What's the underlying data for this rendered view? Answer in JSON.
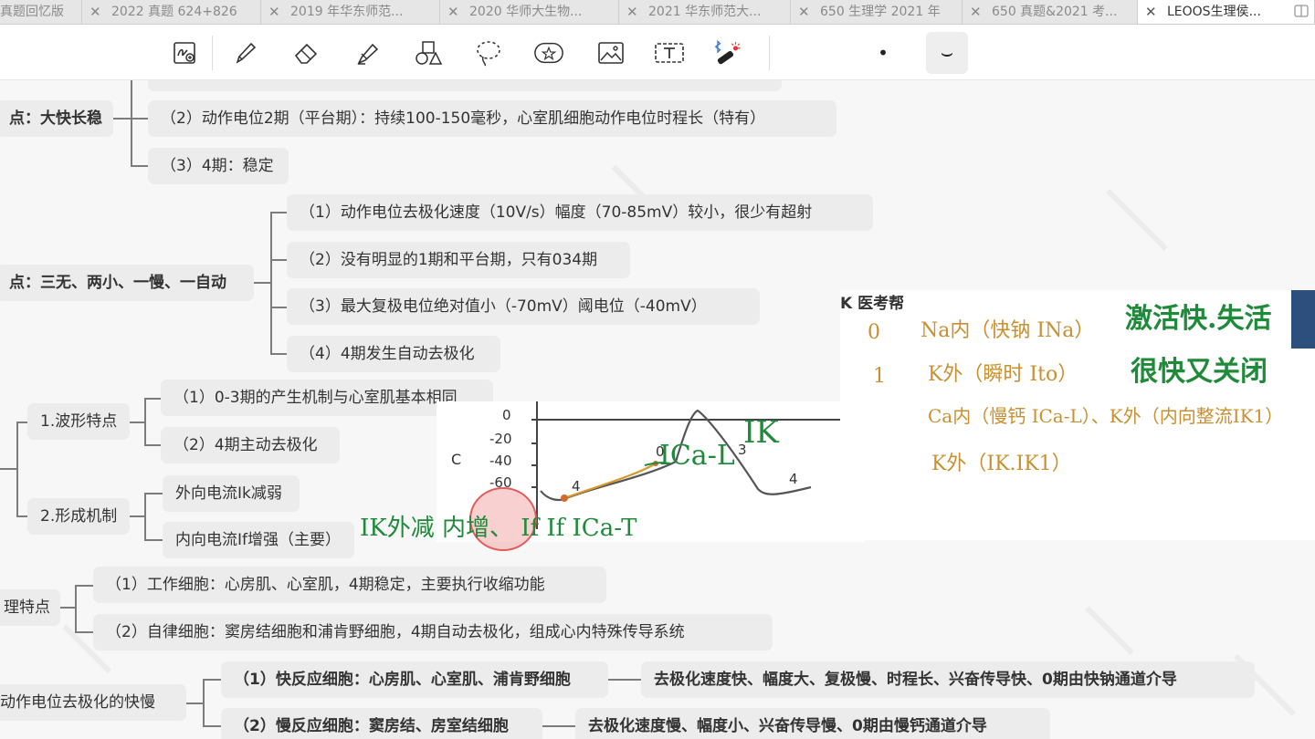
{
  "tabs": [
    {
      "label": "真题回忆版",
      "active": false
    },
    {
      "label": "2022 真题 624+826",
      "active": false
    },
    {
      "label": "2019 年华东师范...",
      "active": false
    },
    {
      "label": "2020 华师大生物...",
      "active": false
    },
    {
      "label": "2021 华东师范大...",
      "active": false
    },
    {
      "label": "650 生理学 2021 年",
      "active": false
    },
    {
      "label": "650 真题&2021 考...",
      "active": false
    },
    {
      "label": "LEOOS生理侯...",
      "active": true
    }
  ],
  "toolbar": {
    "icons": [
      "text-zoom-icon",
      "pen-icon",
      "eraser-icon",
      "highlighter-icon",
      "shapes-icon",
      "lasso-icon",
      "sticker-icon",
      "image-icon",
      "text-box-icon",
      "bluetooth-laser-icon",
      "dot-size-icon",
      "stroke-style-icon"
    ],
    "dot_size": "•",
    "stroke": "⌣"
  },
  "mindmap": {
    "top_partial": "",
    "fast_label": "点：大快长稳",
    "fast_items": [
      "（2）动作电位2期（平台期）：持续100-150毫秒，心室肌细胞动作电位时程长（特有）",
      "（3）4期：稳定"
    ],
    "slow_label": "点：三无、两小、一慢、一自动",
    "slow_items": [
      "（1）动作电位去极化速度（10V/s）幅度（70-85mV）较小，很少有超射",
      "（2）没有明显的1期和平台期，只有034期",
      "（3）最大复极电位绝对值小（-70mV）阈电位（-40mV）",
      "（4）4期发生自动去极化"
    ],
    "wave_label": "1.波形特点",
    "wave_items": [
      "（1）0-3期的产生机制与心室肌基本相同",
      "（2）4期主动去极化"
    ],
    "mech_label": "2.形成机制",
    "mech_items": [
      "外向电流Ik减弱",
      "内向电流If增强（主要）"
    ],
    "phys_label": "理特点",
    "phys_items": [
      "（1）工作细胞：心房肌、心室肌，4期稳定，主要执行收缩功能",
      "（2）自律细胞：窦房结细胞和浦肯野细胞，4期自动去极化，组成心内特殊传导系统"
    ],
    "dep_label": "动作电位去极化的快慢",
    "dep_items": [
      "（1）快反应细胞：心房肌、心室肌、浦肯野细胞",
      "（2）慢反应细胞：窦房结、房室结细胞"
    ],
    "dep_desc": [
      "去极化速度快、幅度大、复极慢、时程长、兴奋传导快、0期由快钠通道介导",
      "去极化速度慢、幅度小、兴奋传导慢、0期由慢钙通道介导"
    ]
  },
  "figure": {
    "ylabel": "C",
    "ticks": [
      "0",
      "-20",
      "-40",
      "-60"
    ],
    "phase_labels": [
      "4",
      "0",
      "3",
      "4"
    ]
  },
  "notes": {
    "brand": "K 医考帮",
    "rows": [
      {
        "phase": "0",
        "text": "Na内（快钠 INa）",
        "comment": "激活快.失活"
      },
      {
        "phase": "1",
        "text": "K外（瞬时 Ito）",
        "comment": "很快又关闭"
      },
      {
        "phase": "",
        "text": "Ca内（慢钙 ICa-L）、K外（内向整流IK1）",
        "comment": ""
      },
      {
        "phase": "",
        "text": "K外（IK.IK1）",
        "comment": ""
      }
    ]
  },
  "annotations": {
    "ical": "ICa-L",
    "ik": "IK",
    "bottom": "IK外减  内增、 If If ICa-T"
  },
  "colors": {
    "handwriting_green": "#1f8a3a",
    "handwriting_orange": "#d59a2a",
    "highlight_red": "#e25c5c"
  }
}
